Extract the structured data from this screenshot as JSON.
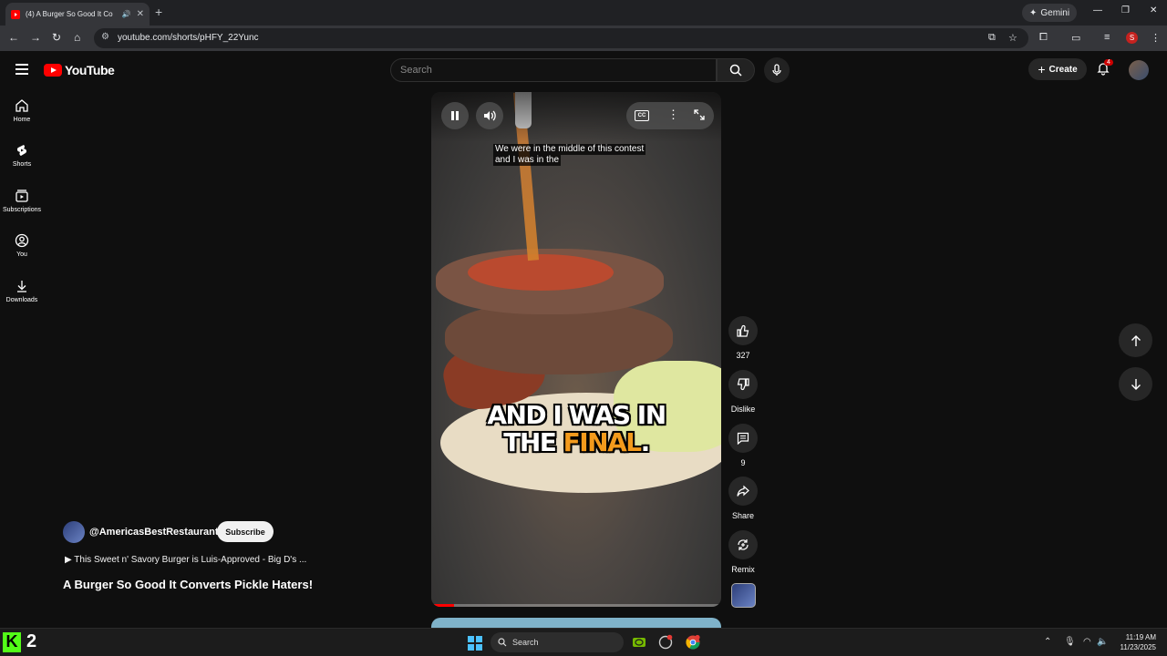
{
  "browser": {
    "tab_title": "(4) A Burger So Good It Co",
    "gemini_label": "Gemini",
    "url": "youtube.com/shorts/pHFY_22Yunc",
    "profile_initial": "S"
  },
  "youtube": {
    "logo_text": "YouTube",
    "search_placeholder": "Search",
    "create_label": "Create",
    "notifications_count": "4",
    "sidebar": [
      {
        "label": "Home",
        "icon": "home-icon"
      },
      {
        "label": "Shorts",
        "icon": "shorts-icon"
      },
      {
        "label": "Subscriptions",
        "icon": "subscriptions-icon"
      },
      {
        "label": "You",
        "icon": "you-icon"
      },
      {
        "label": "Downloads",
        "icon": "download-icon"
      }
    ]
  },
  "video": {
    "caption_line1": "We were in the middle of this contest",
    "caption_line2": "and I was in the",
    "overlay_line1": "AND I WAS IN",
    "overlay_line2_a": "THE ",
    "overlay_line2_b": "FINAL",
    "overlay_line2_c": ".",
    "progress_fraction": 0.08,
    "highlight_color": "#f39a1c"
  },
  "actions": {
    "likes": "327",
    "dislike": "Dislike",
    "comments": "9",
    "share": "Share",
    "remix": "Remix"
  },
  "channel": {
    "handle": "@AmericasBestRestaurants",
    "subscribe": "Subscribe",
    "related": "▶ This Sweet n' Savory Burger is Luis-Approved - Big D's ...",
    "title": "A Burger So Good It Converts Pickle Haters!"
  },
  "taskbar": {
    "k2_label": "2",
    "search": "Search",
    "time": "11:19 AM",
    "date": "11/23/2025"
  }
}
